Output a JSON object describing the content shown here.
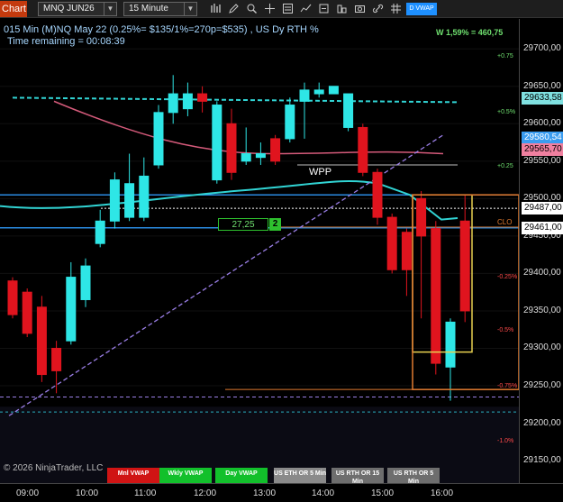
{
  "toolbar": {
    "tab_label": "Chart",
    "instrument": "MNQ JUN26",
    "interval": "15 Minute",
    "vwap_button": "D VWAP"
  },
  "info": {
    "line1": "015 Min (M)NQ May 22 (0.25%= $135/1%=270p=$535) , US Dy RTH %",
    "line2": "Time remaining = 00:08:39",
    "weekly_readout": "W 1,59% = 460,75"
  },
  "colors": {
    "bull": "#2ee6e6",
    "bear": "#e0141e",
    "vwap_cyan": "#31d4d4",
    "pink_ma": "#d45a7a",
    "blue_line": "#2a8ae0",
    "dash_purple": "#9a7ee6"
  },
  "y_axis": {
    "ticks": [
      "29700,00",
      "29650,00",
      "29600,00",
      "29550,00",
      "29500,00",
      "29450,00",
      "29400,00",
      "29350,00",
      "29300,00",
      "29250,00",
      "29200,00",
      "29150,00"
    ],
    "price_tags": [
      {
        "text": "29633,58",
        "bg": "#7fe0e0",
        "fg": "#000"
      },
      {
        "text": "29580,54",
        "bg": "#3a9cf0",
        "fg": "#fff"
      },
      {
        "text": "29565,70",
        "bg": "#f080a0",
        "fg": "#000"
      },
      {
        "text": "29487,00",
        "bg": "#ffffff",
        "fg": "#000"
      },
      {
        "text": "29461,00",
        "bg": "#ffffff",
        "fg": "#000"
      }
    ],
    "clos_label": "CLO"
  },
  "x_axis": {
    "ticks": [
      "09:00",
      "10:00",
      "11:00",
      "12:00",
      "13:00",
      "14:00",
      "15:00",
      "16:00"
    ]
  },
  "pct_labels": {
    "p075": "+0.75",
    "p05": "+0.5%",
    "p025": "+0.25",
    "m025": "-0.25%",
    "m05": "-0.5%",
    "m075": "-0.75%",
    "m1": "-1.0%"
  },
  "annotations": {
    "wpp": "WPP",
    "range_value": "27,25",
    "range_count": "2",
    "copyright": "© 2026 NinjaTrader, LLC"
  },
  "vwap_buttons": [
    {
      "label": "Mnl VWAP",
      "style": "red"
    },
    {
      "label": "Wkly VWAP",
      "style": "green"
    },
    {
      "label": "Day VWAP",
      "style": "green"
    },
    {
      "label": "US ETH OR 5 Min",
      "style": "grey"
    },
    {
      "label": "US RTH OR 15 Min",
      "style": "grey2"
    },
    {
      "label": "US RTH OR 5 Min",
      "style": "grey2"
    }
  ],
  "chart_data": {
    "type": "candlestick",
    "ylim": [
      29120,
      29740
    ],
    "candles": [
      {
        "o": 29390,
        "h": 29395,
        "l": 29340,
        "c": 29345,
        "dir": "bear"
      },
      {
        "o": 29375,
        "h": 29380,
        "l": 29315,
        "c": 29320,
        "dir": "bear"
      },
      {
        "o": 29355,
        "h": 29370,
        "l": 29255,
        "c": 29265,
        "dir": "bear"
      },
      {
        "o": 29300,
        "h": 29310,
        "l": 29240,
        "c": 29270,
        "dir": "bear"
      },
      {
        "o": 29310,
        "h": 29415,
        "l": 29305,
        "c": 29395,
        "dir": "bull"
      },
      {
        "o": 29365,
        "h": 29420,
        "l": 29355,
        "c": 29410,
        "dir": "bull"
      },
      {
        "o": 29440,
        "h": 29485,
        "l": 29435,
        "c": 29470,
        "dir": "bull"
      },
      {
        "o": 29470,
        "h": 29535,
        "l": 29460,
        "c": 29525,
        "dir": "bull"
      },
      {
        "o": 29475,
        "h": 29560,
        "l": 29470,
        "c": 29520,
        "dir": "bull"
      },
      {
        "o": 29475,
        "h": 29555,
        "l": 29470,
        "c": 29530,
        "dir": "bull"
      },
      {
        "o": 29545,
        "h": 29625,
        "l": 29540,
        "c": 29615,
        "dir": "bull"
      },
      {
        "o": 29615,
        "h": 29665,
        "l": 29600,
        "c": 29640,
        "dir": "bull"
      },
      {
        "o": 29620,
        "h": 29655,
        "l": 29610,
        "c": 29640,
        "dir": "bull"
      },
      {
        "o": 29640,
        "h": 29650,
        "l": 29615,
        "c": 29630,
        "dir": "bear"
      },
      {
        "o": 29525,
        "h": 29630,
        "l": 29520,
        "c": 29625,
        "dir": "bull"
      },
      {
        "o": 29600,
        "h": 29620,
        "l": 29525,
        "c": 29535,
        "dir": "bear"
      },
      {
        "o": 29550,
        "h": 29595,
        "l": 29545,
        "c": 29560,
        "dir": "bull"
      },
      {
        "o": 29560,
        "h": 29575,
        "l": 29545,
        "c": 29555,
        "dir": "bull"
      },
      {
        "o": 29580,
        "h": 29585,
        "l": 29545,
        "c": 29550,
        "dir": "bear"
      },
      {
        "o": 29580,
        "h": 29635,
        "l": 29575,
        "c": 29625,
        "dir": "bull"
      },
      {
        "o": 29630,
        "h": 29655,
        "l": 29580,
        "c": 29645,
        "dir": "bull"
      },
      {
        "o": 29645,
        "h": 29655,
        "l": 29635,
        "c": 29640,
        "dir": "bull"
      },
      {
        "o": 29640,
        "h": 29650,
        "l": 29640,
        "c": 29650,
        "dir": "bull"
      },
      {
        "o": 29640,
        "h": 29640,
        "l": 29590,
        "c": 29595,
        "dir": "bull"
      },
      {
        "o": 29595,
        "h": 29600,
        "l": 29530,
        "c": 29535,
        "dir": "bear"
      },
      {
        "o": 29535,
        "h": 29540,
        "l": 29465,
        "c": 29475,
        "dir": "bear"
      },
      {
        "o": 29475,
        "h": 29480,
        "l": 29400,
        "c": 29405,
        "dir": "bear"
      },
      {
        "o": 29455,
        "h": 29460,
        "l": 29370,
        "c": 29405,
        "dir": "bear"
      },
      {
        "o": 29500,
        "h": 29510,
        "l": 29340,
        "c": 29450,
        "dir": "bear"
      },
      {
        "o": 29460,
        "h": 29470,
        "l": 29265,
        "c": 29280,
        "dir": "bear"
      },
      {
        "o": 29275,
        "h": 29340,
        "l": 29230,
        "c": 29335,
        "dir": "bull"
      },
      {
        "o": 29470,
        "h": 29505,
        "l": 29335,
        "c": 29350,
        "dir": "bear"
      }
    ],
    "levels": [
      {
        "name": "vwap-upper",
        "price": 29633.58
      },
      {
        "name": "blue-upper",
        "price": 29505
      },
      {
        "name": "blue-lower",
        "price": 29461
      },
      {
        "name": "white-dotted",
        "price": 29487
      },
      {
        "name": "purple-dashed",
        "price": 29235
      },
      {
        "name": "cyan-dashed-low",
        "price": 29215
      }
    ]
  }
}
